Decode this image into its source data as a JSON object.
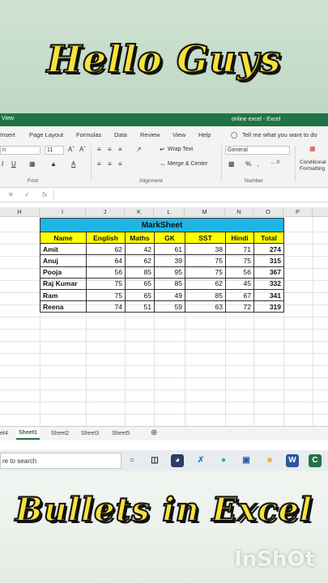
{
  "banner_top": "Hello Guys",
  "banner_bottom": "Bullets in Excel",
  "watermark": "InShOt",
  "titlebar": {
    "view_label": "View",
    "doc_title": "online excel  -  Excel"
  },
  "menu": [
    "Insert",
    "Page Layout",
    "Formulas",
    "Data",
    "Review",
    "View",
    "Help"
  ],
  "tell_me": "Tell me what you want to do",
  "ribbon": {
    "font_name": "ri",
    "font_size": "11",
    "wrap_text": "Wrap Text",
    "merge_center": "Merge & Center",
    "number_format": "General",
    "conditional": "Conditional",
    "formatting": "Formatting",
    "group_font": "Font",
    "group_alignment": "Alignment",
    "group_number": "Number",
    "percent": "%"
  },
  "formula": {
    "fx": "fx"
  },
  "columns": [
    "H",
    "I",
    "J",
    "K",
    "L",
    "M",
    "N",
    "O",
    "P"
  ],
  "table": {
    "title": "MarkSheet",
    "headers": [
      "Name",
      "English",
      "Maths",
      "GK",
      "SST",
      "Hindi",
      "Total"
    ],
    "rows": [
      [
        "Amit",
        "62",
        "42",
        "61",
        "38",
        "71",
        "274"
      ],
      [
        "Anuj",
        "64",
        "62",
        "39",
        "75",
        "75",
        "315"
      ],
      [
        "Pooja",
        "56",
        "85",
        "95",
        "75",
        "56",
        "367"
      ],
      [
        "Raj Kumar",
        "75",
        "65",
        "85",
        "62",
        "45",
        "332"
      ],
      [
        "Ram",
        "75",
        "65",
        "49",
        "85",
        "67",
        "341"
      ],
      [
        "Reena",
        "74",
        "51",
        "59",
        "63",
        "72",
        "319"
      ]
    ]
  },
  "sheets": [
    "et4",
    "Sheet1",
    "Sheet2",
    "Sheet3",
    "Sheet5"
  ],
  "taskbar": {
    "search_text": "re to search"
  }
}
